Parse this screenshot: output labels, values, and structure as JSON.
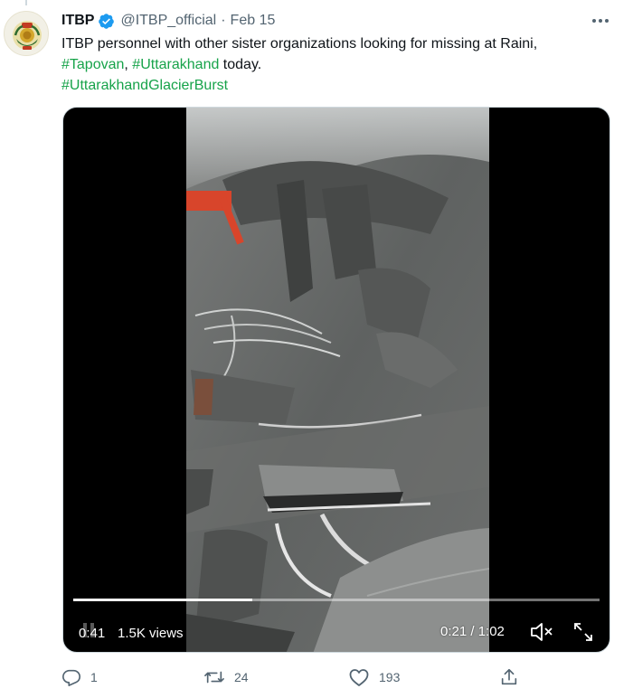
{
  "tweet": {
    "author_name": "ITBP",
    "handle": "@ITBP_official",
    "separator": "·",
    "date": "Feb 15",
    "text_line1": "ITBP personnel with other sister organizations looking for missing at Raini,",
    "hashtag1": "#Tapovan",
    "comma": ",",
    "hashtag2": "#Uttarakhand",
    "text_after": " today.",
    "hashtag3": "#UttarakhandGlacierBurst"
  },
  "video": {
    "badge_time": "0:41",
    "views": "1.5K views",
    "elapsed_remaining": "0:21 / 1:02",
    "progress_fraction": 0.34
  },
  "actions": {
    "reply_count": "1",
    "retweet_count": "24",
    "like_count": "193"
  },
  "colors": {
    "hashtag": "#17a34a",
    "secondary_text": "#536471",
    "verified_badge": "#1d9bf0"
  },
  "icons": [
    "verified-badge-icon",
    "more-icon",
    "pause-icon",
    "mute-icon",
    "fullscreen-icon",
    "reply-icon",
    "retweet-icon",
    "like-icon",
    "share-icon"
  ]
}
